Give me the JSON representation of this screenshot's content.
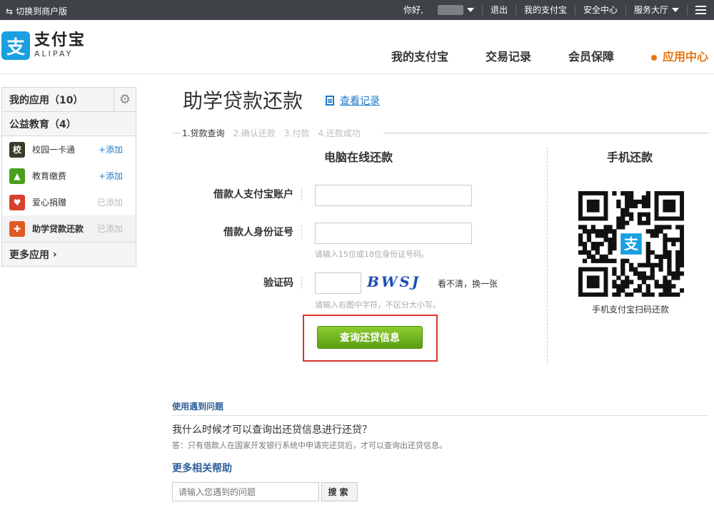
{
  "topbar": {
    "switch_label": "切换到商户版",
    "greeting": "你好,",
    "logout": "退出",
    "my_alipay": "我的支付宝",
    "security": "安全中心",
    "service": "服务大厅"
  },
  "header": {
    "logo_cn": "支付宝",
    "logo_en": "ALIPAY",
    "logo_mark": "支",
    "nav": [
      "我的支付宝",
      "交易记录",
      "会员保障",
      "应用中心"
    ],
    "active_nav": "应用中心"
  },
  "sidebar": {
    "my_apps": "我的应用（10）",
    "category": "公益教育（4）",
    "items": [
      {
        "label": "校园一卡通",
        "action": "+添加",
        "icon_text": "校",
        "icon_color": "#3a3a2a"
      },
      {
        "label": "教育缴费",
        "action": "+添加",
        "icon_text": "▲",
        "icon_color": "#4aa01c"
      },
      {
        "label": "爱心捐赠",
        "action": "已添加",
        "icon_text": "♥",
        "icon_color": "#d8402f"
      },
      {
        "label": "助学贷款还款",
        "action": "已添加",
        "icon_text": "✚",
        "icon_color": "#e05a28"
      }
    ],
    "more": "更多应用"
  },
  "main": {
    "title": "助学贷款还款",
    "view_log": "查看记录",
    "steps": [
      "1.贷款查询",
      "2.确认还款",
      "3.付款",
      "4.还款成功"
    ],
    "online_title": "电脑在线还款",
    "mobile_title": "手机还款",
    "form": {
      "account_label": "借款人支付宝账户",
      "id_label": "借款人身份证号",
      "id_hint": "请输入15位或18位身份证号码。",
      "captcha_label": "验证码",
      "captcha_text": "BWSJ",
      "refresh": "看不清，换一张",
      "captcha_hint": "请输入右图中字符，不区分大小写。",
      "submit": "查询还贷信息"
    },
    "qr_caption": "手机支付宝扫码还款"
  },
  "faq": {
    "heading": "使用遇到问题",
    "question": "我什么时候才可以查询出还贷信息进行还贷？",
    "answer": "答：只有借款人在国家开发银行系统中申请完还贷后，才可以查询出还贷信息。",
    "more_help": "更多相关帮助",
    "search_placeholder": "请输入您遇到的问题",
    "search_button": "搜索"
  },
  "colors": {
    "accent_orange": "#e87512",
    "link_blue": "#1e7ac8",
    "alipay_blue": "#1a9fe0",
    "submit_green": "#6cb11d",
    "highlight_red": "#d9352b"
  }
}
